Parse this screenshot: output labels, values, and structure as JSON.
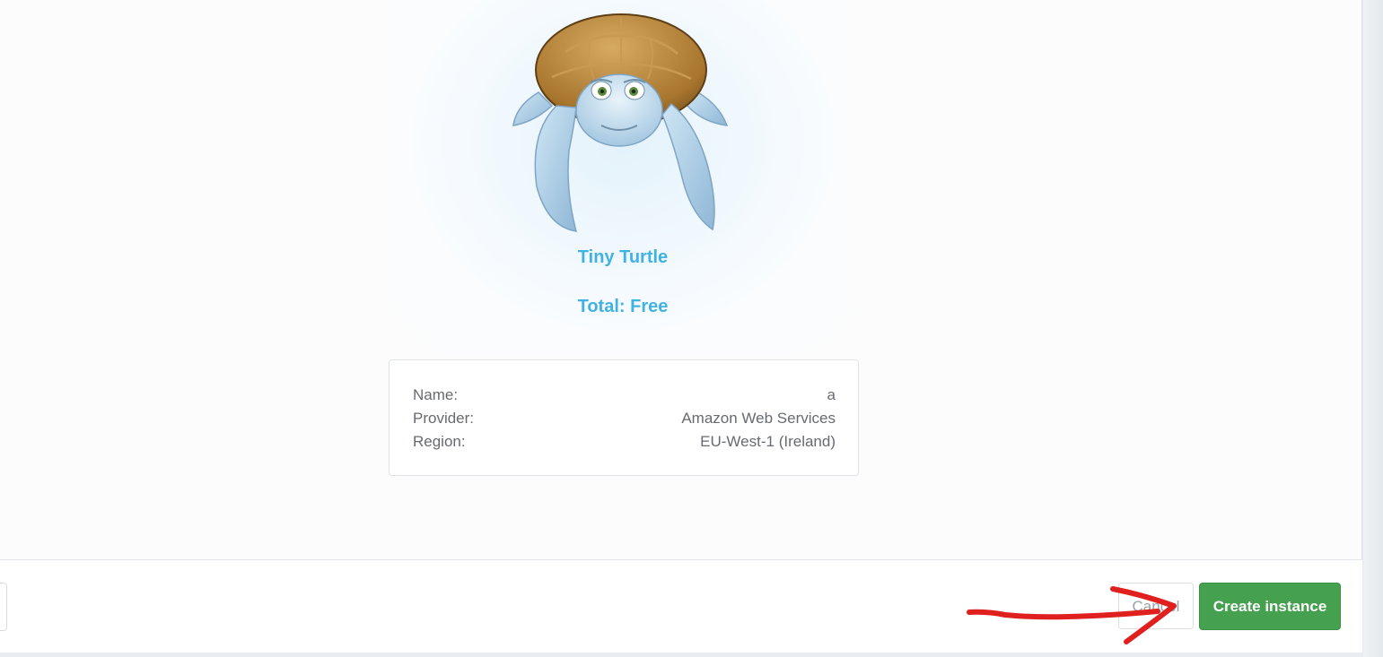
{
  "plan": {
    "name": "Tiny Turtle",
    "total": "Total: Free",
    "illustration": "turtle-mascot"
  },
  "summary": {
    "rows": [
      {
        "label": "Name:",
        "value": "a"
      },
      {
        "label": "Provider:",
        "value": "Amazon Web Services"
      },
      {
        "label": "Region:",
        "value": "EU-West-1 (Ireland)"
      }
    ]
  },
  "footer": {
    "cancel_label": "Cancel",
    "create_label": "Create instance"
  },
  "colors": {
    "accent": "#41b3e3",
    "primary_button": "#45a04f",
    "annotation": "#e0201f"
  },
  "annotation": {
    "icon": "red-arrow-icon"
  }
}
